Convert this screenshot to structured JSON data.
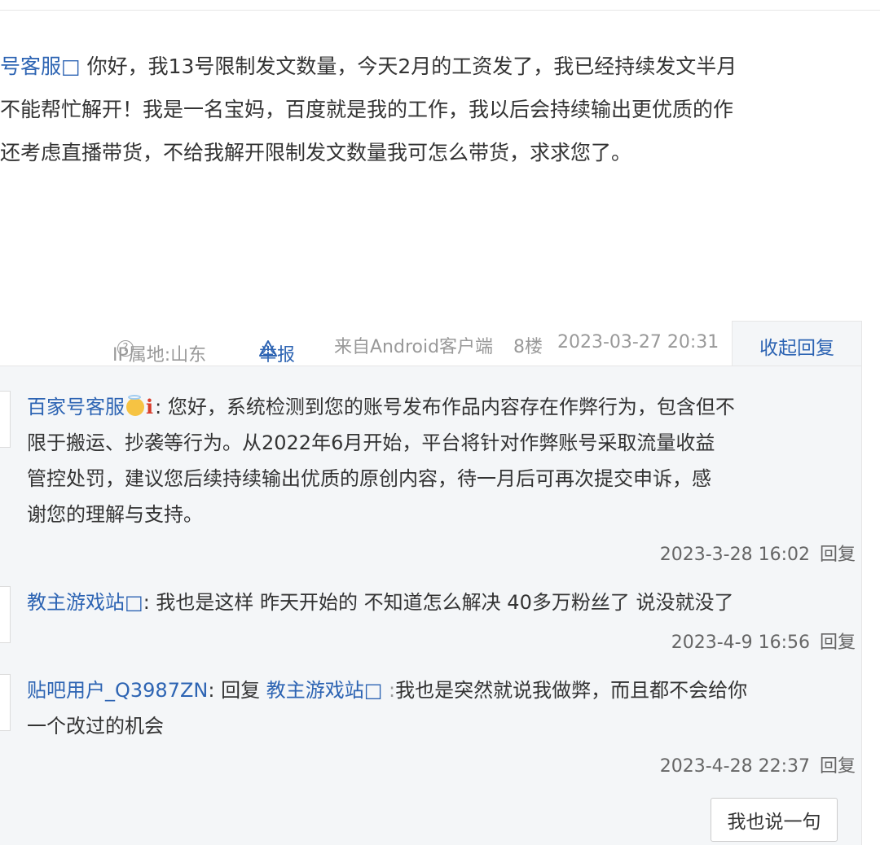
{
  "post": {
    "lines": [
      {
        "user": "号客服□",
        "text": " 你好，我13号限制发文数量，今天2月的工资发了，我已经持续发文半月"
      },
      {
        "user": "",
        "text": "不能帮忙解开！我是一名宝妈，百度就是我的工作，我以后会持续输出更优质的作"
      },
      {
        "user": "",
        "text": "还考虑直播带货，不给我解开限制发文数量我可怎么带货，求求您了。"
      }
    ],
    "meta": {
      "ip": "IP属地:山东",
      "help_symbol": "?",
      "report": "举报",
      "source": "来自Android客户端",
      "floor": "8楼",
      "datetime": "2023-03-27 20:31"
    },
    "collapse_label": "收起回复"
  },
  "replies": [
    {
      "user": "百家号客服",
      "badge_i": "i",
      "separator": ":",
      "lines": [
        " 您好，系统检测到您的账号发布作品内容存在作弊行为，包含但不",
        "限于搬运、抄袭等行为。从2022年6月开始，平台将针对作弊账号采取流量收益",
        "管控处罚，建议您后续持续输出优质的原创内容，待一月后可再次提交申诉，感",
        "谢您的理解与支持。"
      ],
      "time": "2023-3-28 16:02",
      "reply_label": "回复"
    },
    {
      "user": "教主游戏站□",
      "separator": ":",
      "lines": [
        " 我也是这样 昨天开始的 不知道怎么解决 40多万粉丝了 说没就没了"
      ],
      "time": "2023-4-9 16:56",
      "reply_label": "回复"
    },
    {
      "user": "贴吧用户_Q3987ZN",
      "separator": ":",
      "reply_word": " 回复 ",
      "target_user": "教主游戏站□",
      "target_separator": " :",
      "lines": [
        "我也是突然就说我做弊，而且都不会给你",
        "一个改过的机会"
      ],
      "time": "2023-4-28 22:37",
      "reply_label": "回复"
    }
  ],
  "say_button": "我也说一句",
  "colors": {
    "link": "#2d64b3",
    "panel_bg": "#f4f6f8",
    "meta_text": "#999999",
    "badge_red": "#d83c2a"
  }
}
